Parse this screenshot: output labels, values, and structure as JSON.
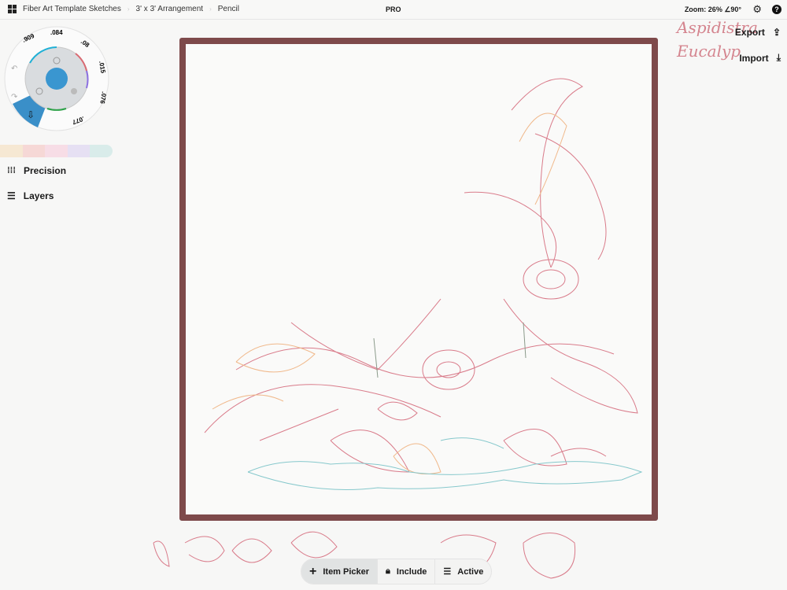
{
  "topbar": {
    "breadcrumbs": [
      "Fiber Art Template Sketches",
      "3' x 3' Arrangement",
      "Pencil"
    ],
    "badge": "PRO",
    "zoom": "Zoom: 26% ∠90°"
  },
  "brush_wheel": {
    "sizes": [
      ".909",
      ".084",
      ".08",
      ".015",
      ".076",
      ".077"
    ],
    "active_color": "#3a96d0"
  },
  "palette": [
    "#f6e8d3",
    "#f6d8d6",
    "#f7dde6",
    "#e6e0f3",
    "#d9ecea"
  ],
  "sidebar": {
    "precision": "Precision",
    "layers": "Layers"
  },
  "actions": {
    "export": "Export",
    "import": "Import"
  },
  "canvas": {
    "frame_color": "#7e4a4b",
    "handwriting": [
      "Aspidistra",
      "Eucalyp"
    ]
  },
  "toolbar": {
    "item_picker": "Item Picker",
    "include": "Include",
    "active": "Active"
  }
}
